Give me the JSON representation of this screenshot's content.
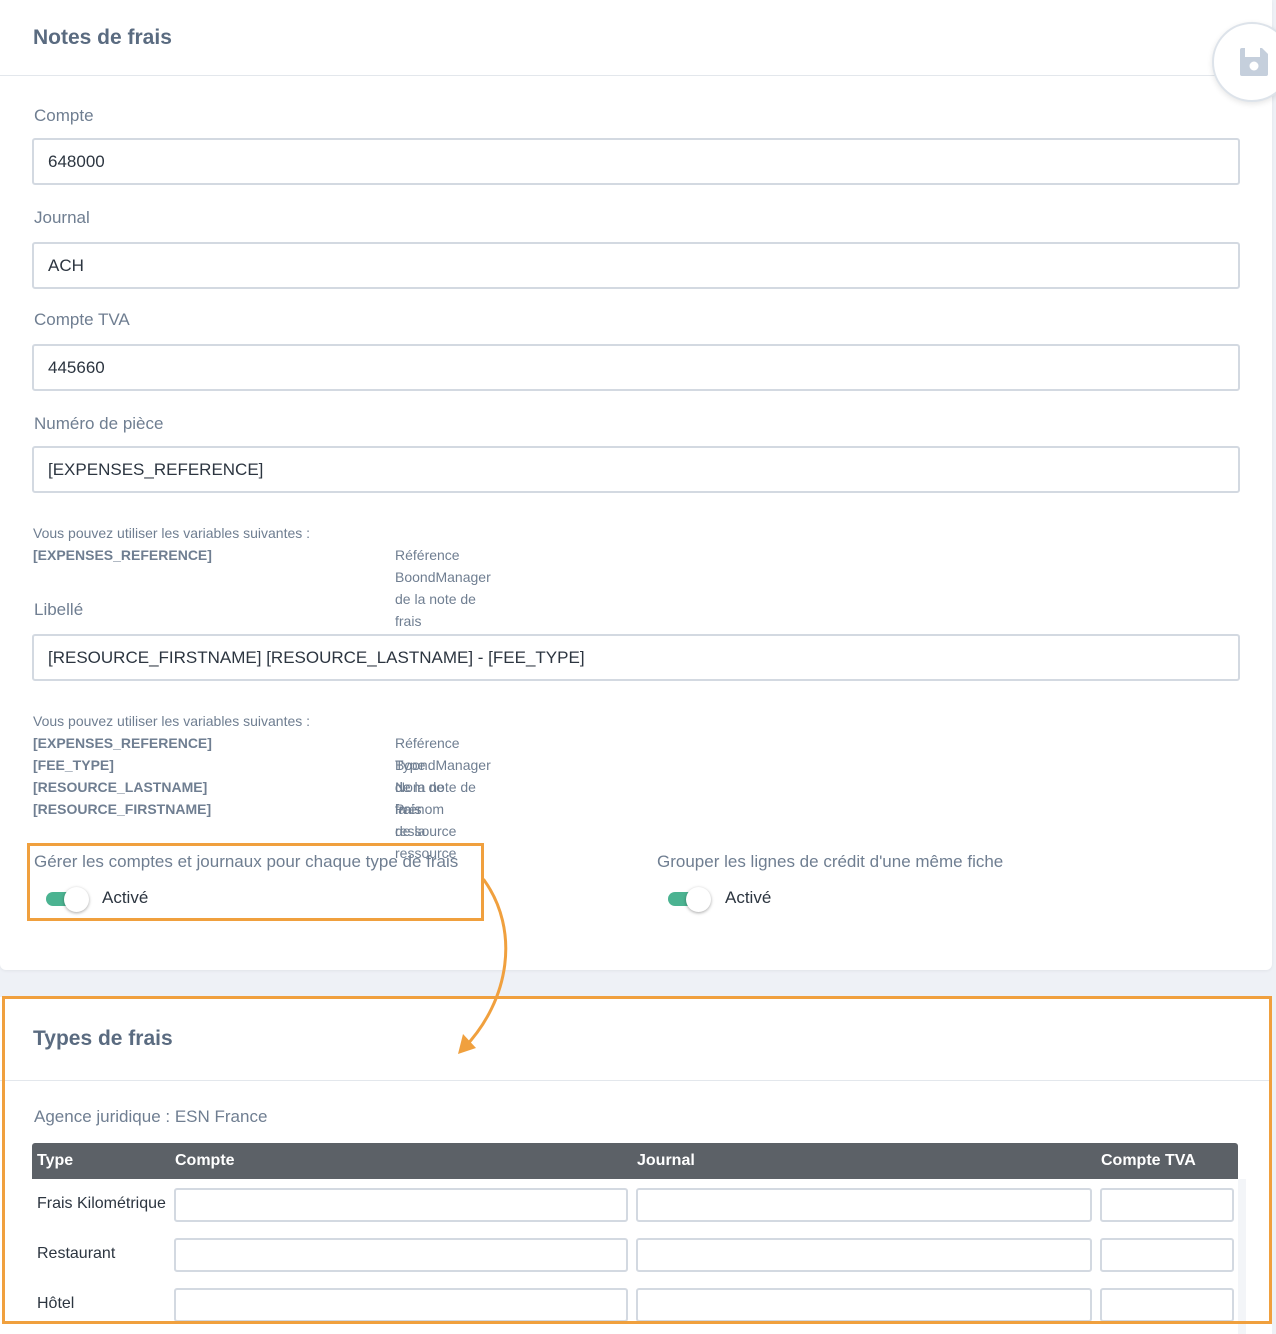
{
  "notes_card": {
    "title": "Notes de frais",
    "save_icon": "floppy-disk-icon",
    "fields": [
      {
        "label": "Compte",
        "value": "648000"
      },
      {
        "label": "Journal",
        "value": "ACH"
      },
      {
        "label": "Compte TVA",
        "value": "445660"
      },
      {
        "label": "Numéro de pièce",
        "value": "[EXPENSES_REFERENCE]"
      },
      {
        "label": "Libellé",
        "value": "[RESOURCE_FIRSTNAME] [RESOURCE_LASTNAME] - [FEE_TYPE]"
      }
    ],
    "vars_piece": {
      "intro": "Vous pouvez utiliser les variables suivantes :",
      "rows": [
        {
          "key": "[EXPENSES_REFERENCE]",
          "desc": "Référence BoondManager de la note de frais"
        }
      ]
    },
    "vars_libelle": {
      "intro": "Vous pouvez utiliser les variables suivantes :",
      "rows": [
        {
          "key": "[EXPENSES_REFERENCE]",
          "desc": "Référence BoondManager de la note de frais"
        },
        {
          "key": "[FEE_TYPE]",
          "desc": "Type de frais"
        },
        {
          "key": "[RESOURCE_LASTNAME]",
          "desc": "Nom de la ressource"
        },
        {
          "key": "[RESOURCE_FIRSTNAME]",
          "desc": "Prénom de la ressource"
        }
      ]
    },
    "toggles": [
      {
        "label": "Gérer les comptes et journaux pour chaque type de frais",
        "state": "Activé",
        "on": true
      },
      {
        "label": "Grouper les lignes de crédit d'une même fiche",
        "state": "Activé",
        "on": true
      }
    ]
  },
  "types_card": {
    "title": "Types de frais",
    "agency": "Agence juridique : ESN France",
    "columns": [
      "Type",
      "Compte",
      "Journal",
      "Compte TVA"
    ],
    "rows": [
      {
        "type": "Frais Kilométrique",
        "compte": "",
        "journal": "",
        "compte_tva": ""
      },
      {
        "type": "Restaurant",
        "compte": "",
        "journal": "",
        "compte_tva": ""
      },
      {
        "type": "Hôtel",
        "compte": "",
        "journal": "",
        "compte_tva": ""
      }
    ]
  },
  "colors": {
    "highlight": "#f0a03e",
    "toggle_on": "#4bb391",
    "table_header": "#5c6167"
  }
}
